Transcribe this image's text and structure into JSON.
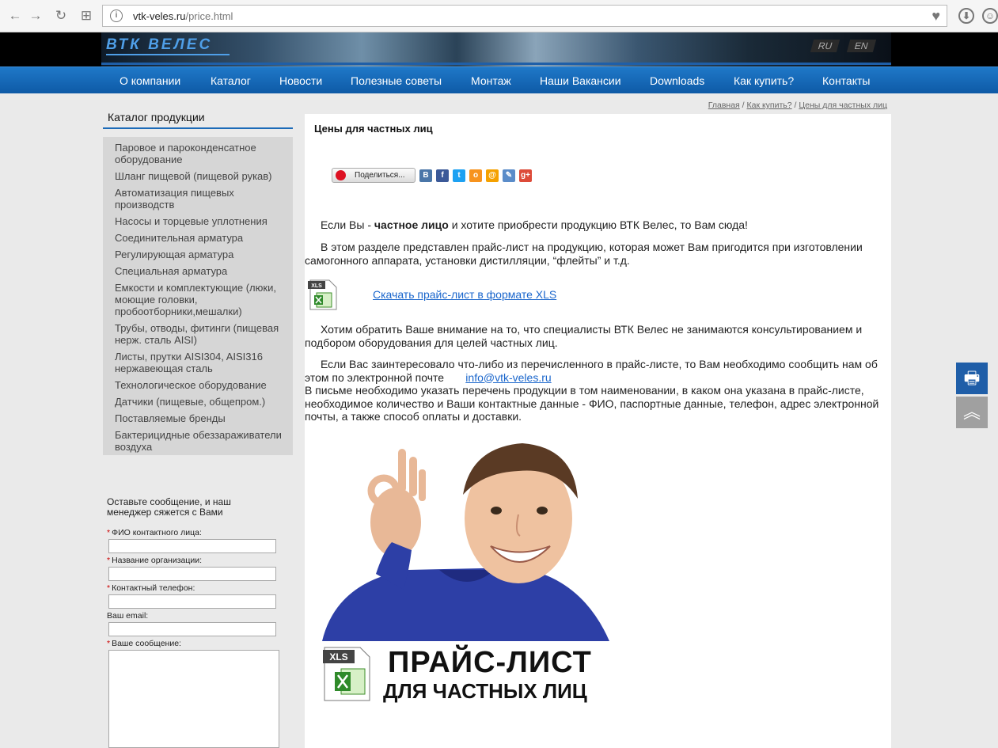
{
  "browser": {
    "url_host": "vtk-veles.ru",
    "url_path": "/price.html",
    "back_icon": "←",
    "forward_icon": "→",
    "reload_icon": "↻",
    "apps_icon": "⊞",
    "info_icon": "i",
    "bookmark_icon": "♥",
    "download_icon": "⬇",
    "menu_icon": "☺"
  },
  "header": {
    "logo": "ВТК ВЕЛЕС",
    "lang_ru": "RU",
    "lang_en": "EN"
  },
  "nav": {
    "items": [
      "О компании",
      "Каталог",
      "Новости",
      "Полезные советы",
      "Монтаж",
      "Наши Вакансии",
      "Downloads",
      "Как купить?",
      "Контакты"
    ]
  },
  "breadcrumb": {
    "home": "Главная",
    "sep": " / ",
    "how_to_buy": "Как купить?",
    "current": "Цены для частных лиц"
  },
  "sidebar": {
    "catalog_title": "Каталог продукции",
    "items": [
      "Паровое и пароконденсатное оборудование",
      "Шланг пищевой (пищевой рукав)",
      "Автоматизация пищевых производств",
      "Насосы и торцевые уплотнения",
      "Соединительная арматура",
      "Регулирующая арматура",
      "Специальная арматура",
      "Емкости и комплектующие (люки, моющие головки, пробоотборники,мешалки)",
      "Трубы, отводы, фитинги (пищевая нерж. сталь AISI)",
      "Листы, прутки AISI304, AISI316 нержавеющая сталь",
      "Технологическое оборудование",
      "Датчики (пищевые, общепром.)",
      "Поставляемые бренды",
      "Бактерицидные обеззараживатели воздуха"
    ],
    "form": {
      "intro": "Оставьте сообщение, и наш менеджер сяжется с Вами",
      "required_mark": "*",
      "fio_label": "ФИО контактного лица:",
      "org_label": "Название организации:",
      "phone_label": "Контактный телефон:",
      "email_label": "Ваш email:",
      "message_label": "Ваше сообщение:"
    }
  },
  "content": {
    "title": "Цены для частных лиц",
    "share_label": "Поделиться...",
    "social": [
      {
        "name": "vk-icon",
        "glyph": "B",
        "color": "#4a76a8"
      },
      {
        "name": "facebook-icon",
        "glyph": "f",
        "color": "#3b5998"
      },
      {
        "name": "twitter-icon",
        "glyph": "t",
        "color": "#1da1f2"
      },
      {
        "name": "odnoklassniki-icon",
        "glyph": "о",
        "color": "#f7931e"
      },
      {
        "name": "mailru-icon",
        "glyph": "@",
        "color": "#f5a100"
      },
      {
        "name": "livejournal-icon",
        "glyph": "✎",
        "color": "#5a8cc9"
      },
      {
        "name": "googleplus-icon",
        "glyph": "g+",
        "color": "#dd4b39"
      }
    ],
    "p1_pre": "Если Вы - ",
    "p1_bold": "частное лицо",
    "p1_post": " и хотите приобрести продукцию ВТК Велес, то Вам сюда!",
    "p2": "В этом разделе представлен прайс-лист на продукцию, которая может Вам пригодится при изготовлении самогонного аппарата, установки дистилляции, “флейты” и т.д.",
    "xls_label": "XLS",
    "download_link": "Скачать прайс-лист в формате XLS",
    "p3": "Хотим обратить Ваше внимание на то, что специалисты ВТК Велес не занимаются консультированием и подбором оборудования для целей частных лиц.",
    "p4_pre": "Если Вас заинтересовало что-либо из перечисленного в прайс-листе, то Вам необходимо сообщить нам об этом по электронной почте",
    "p4_email": "info@vtk-veles.ru",
    "p4_post": "В письме необходимо указать перечень продукции в том наименовании, в каком она указана в прайс-листе, необходимое количество и Ваши контактные данные - ФИО, паспортные данные, телефон, адрес электронной почты, а также способ оплаты и доставки.",
    "promo_xls": "XLS",
    "promo_title1": "ПРАЙС-ЛИСТ",
    "promo_title2": "ДЛЯ ЧАСТНЫХ ЛИЦ"
  },
  "floating": {
    "print_icon": "🖶",
    "up_icon": "︽"
  }
}
